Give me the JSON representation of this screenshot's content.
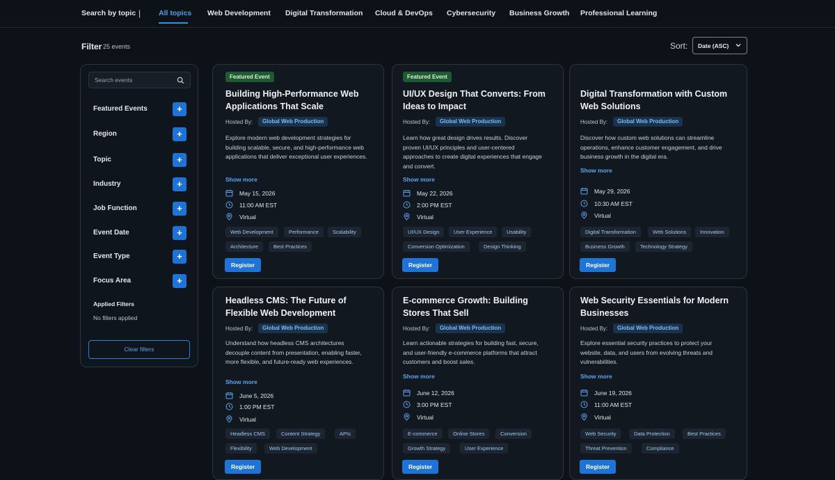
{
  "topnav": {
    "lead": "Search by topic",
    "separator": "|",
    "tabs": [
      "All topics",
      "Web Development",
      "Digital Transformation",
      "Cloud & DevOps",
      "Cybersecurity",
      "Business Growth",
      "Professional Learning"
    ],
    "active_tab": "All topics"
  },
  "filter": {
    "title": "Filter",
    "count": "25 events",
    "sort_label": "Sort:",
    "sort_value": "Date (ASC)"
  },
  "sidebar": {
    "search_placeholder": "Search events",
    "filters": [
      "Featured Events",
      "Region",
      "Topic",
      "Industry",
      "Job Function",
      "Event Date",
      "Event Type",
      "Focus Area"
    ],
    "plus": "+",
    "applied_title": "Applied Filters",
    "applied_none": "No filters applied",
    "clear_label": "Clear filters"
  },
  "common": {
    "hosted_by": "Hosted By:",
    "show_more": "Show more",
    "register": "Register"
  },
  "cards": [
    {
      "featured": "Featured Event",
      "title": "Building High-Performance Web Applications That Scale",
      "host": "Global Web Production",
      "desc": "Explore modern web development strategies for building scalable, secure, and high-performance web applications that deliver exceptional user experiences.",
      "date": "May 15, 2026",
      "time": "11:00 AM EST",
      "location": "Virtual",
      "tags_row1": [
        "Web Development",
        "Performance",
        "Scalability"
      ],
      "tags_row2": [
        "Architecture",
        "Best Practices"
      ]
    },
    {
      "featured": "Featured Event",
      "title": "UI/UX Design That Converts: From Ideas to Impact",
      "host": "Global Web Production",
      "desc": "Learn how great design drives results. Discover proven UI/UX principles and user-centered approaches to create digital experiences that engage and convert.",
      "date": "May 22, 2026",
      "time": "2:00 PM EST",
      "location": "Virtual",
      "tags_row1": [
        "UI/UX Design",
        "User Experience",
        "Usability"
      ],
      "tags_row2": [
        "Conversion Optimization",
        "Design Thinking"
      ]
    },
    {
      "featured": "",
      "title": "Digital Transformation with Custom Web Solutions",
      "host": "Global Web Production",
      "desc": "Discover how custom web solutions can streamline operations, enhance customer engagement, and drive business growth in the digital era.",
      "date": "May 29, 2026",
      "time": "10:30 AM EST",
      "location": "Virtual",
      "tags_row1": [
        "Digital Transformation",
        "Web Solutions",
        "Innovation"
      ],
      "tags_row2": [
        "Business Growth",
        "Technology Strategy"
      ]
    },
    {
      "featured": "",
      "title": "Headless CMS: The Future of Flexible Web Development",
      "host": "Global Web Production",
      "desc": "Understand how headless CMS architectures decouple content from presentation, enabling faster, more flexible, and future-ready web experiences.",
      "date": "June 5, 2026",
      "time": "1:00 PM EST",
      "location": "Virtual",
      "tags_row1": [
        "Headless CMS",
        "Content Strategy",
        "APIs"
      ],
      "tags_row2": [
        "Flexibility",
        "Web Development"
      ]
    },
    {
      "featured": "",
      "title": "E-commerce Growth: Building Stores That Sell",
      "host": "Global Web Production",
      "desc": "Learn actionable strategies for building fast, secure, and user-friendly e-commerce platforms that attract customers and boost sales.",
      "date": "June 12, 2026",
      "time": "3:00 PM EST",
      "location": "Virtual",
      "tags_row1": [
        "E-commerce",
        "Online Stores",
        "Conversion"
      ],
      "tags_row2": [
        "Growth Strategy",
        "User Experience"
      ]
    },
    {
      "featured": "",
      "title": "Web Security Essentials for Modern Businesses",
      "host": "Global Web Production",
      "desc": "Explore essential security practices to protect your website, data, and users from evolving threats and vulnerabilities.",
      "date": "June 19, 2026",
      "time": "11:00 AM EST",
      "location": "Virtual",
      "tags_row1": [
        "Web Security",
        "Data Protection",
        "Best Practices"
      ],
      "tags_row2": [
        "Threat Prevention",
        "Compliance"
      ]
    }
  ]
}
